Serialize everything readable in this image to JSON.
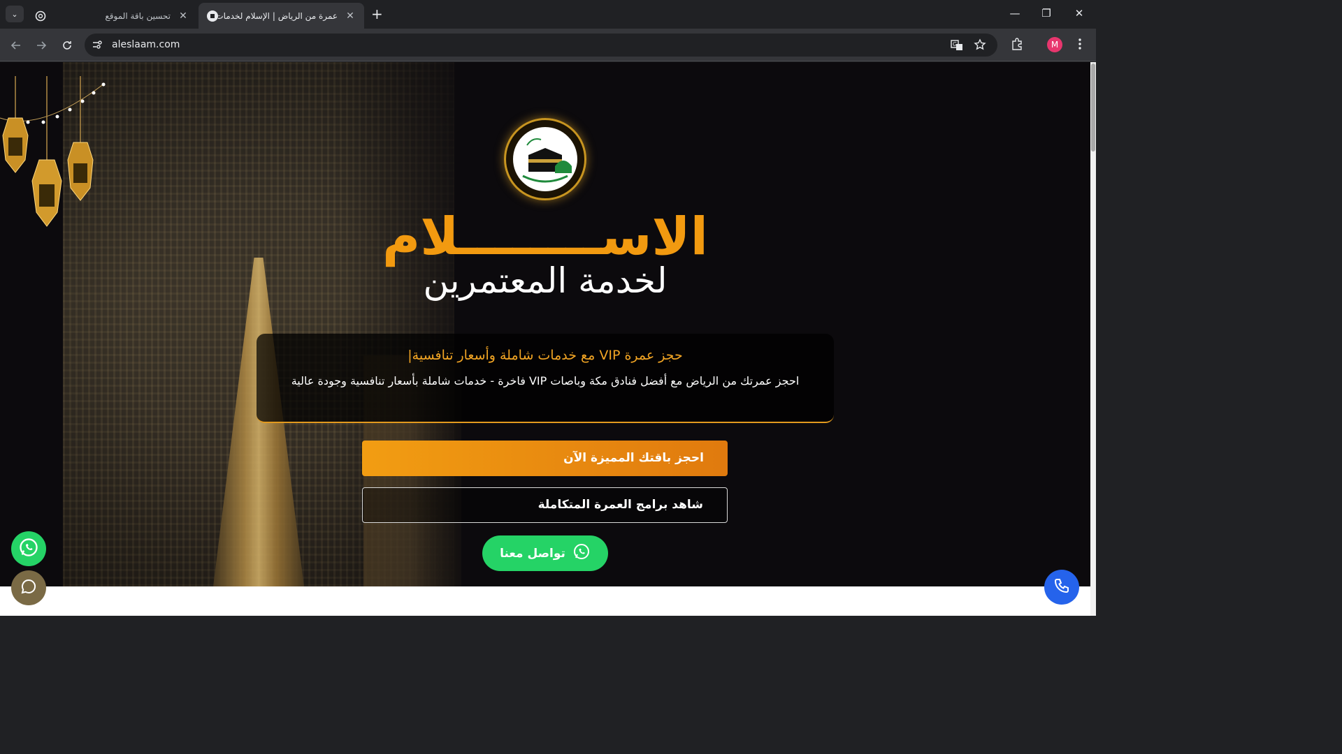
{
  "browser": {
    "tabs": [
      {
        "title": "تحسين باقة الموقع",
        "active": false,
        "favicon": "chatgpt-icon"
      },
      {
        "title": "عمرة من الرياض | الإسلام لخدمات",
        "active": true,
        "favicon": "site-logo-icon"
      }
    ],
    "url": "aleslaam.com",
    "profile_initial": "M"
  },
  "hero": {
    "brand_main": "الاســــــــلام",
    "brand_sub": "لخدمة المعتمرين",
    "card_title": "حجز عمرة VIP مع خدمات شاملة وأسعار تنافسية|",
    "card_description": "احجز عمرتك من الرياض مع أفضل فنادق مكة وباصات VIP فاخرة - خدمات شاملة بأسعار تنافسية وجودة عالية",
    "primary_button": "احجز باقتك المميزة الآن",
    "secondary_button": "شاهد برامج العمرة المتكاملة",
    "contact_button": "تواصل معنا"
  },
  "colors": {
    "accent_orange": "#f29a10",
    "whatsapp_green": "#25d366",
    "phone_blue": "#2563eb",
    "hero_bg": "#0c0a0d"
  }
}
